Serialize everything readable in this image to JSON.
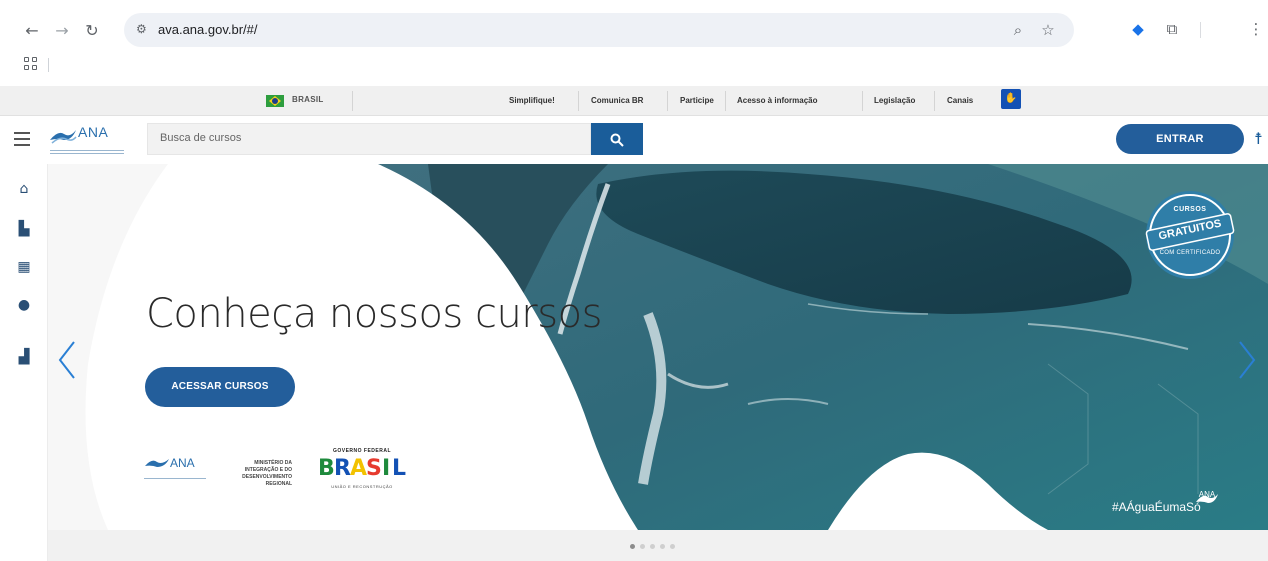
{
  "browser": {
    "url": "ava.ana.gov.br/#/",
    "back_icon": "arrow-left-icon",
    "forward_icon": "arrow-right-icon",
    "reload_icon": "reload-icon",
    "site_info_icon": "tune-icon",
    "zoom_icon": "zoom-icon",
    "bookmark_icon": "star-icon",
    "extension_icon": "extension-icon",
    "menu_icon": "kebab-menu-icon"
  },
  "govbar": {
    "brasil_label": "BRASIL",
    "links": [
      "Simplifique!",
      "Comunica BR",
      "Participe",
      "Acesso à informação",
      "Legislação",
      "Canais"
    ]
  },
  "header": {
    "logo_text": "ANA",
    "search_placeholder": "Busca de cursos",
    "login_label": "ENTRAR"
  },
  "sidebar": {
    "items": [
      {
        "icon": "home-icon"
      },
      {
        "icon": "institution-icon"
      },
      {
        "icon": "catalog-icon"
      },
      {
        "icon": "help-icon"
      },
      {
        "icon": "bar-chart-icon"
      }
    ]
  },
  "hero": {
    "title": "Conheça nossos cursos",
    "cta_label": "ACESSAR CURSOS",
    "badge_top": "CURSOS",
    "badge_main": "GRATUITOS",
    "badge_bottom": "COM CERTIFICADO",
    "hashtag": "#AÁguaÉumaSó",
    "corner_logo": "ANA",
    "partner_ana": "ANA",
    "ministry": "MINISTÉRIO DA INTEGRAÇÃO E DO DESENVOLVIMENTO REGIONAL",
    "gov_top": "GOVERNO FEDERAL",
    "gov_word": "BRASIL",
    "gov_bottom": "UNIÃO E RECONSTRUÇÃO"
  },
  "carousel": {
    "slide_count": 5,
    "active_slide": 1
  },
  "colors": {
    "primary": "#235e9b",
    "accent_blue": "#1351b4",
    "hero_water": "#2d6a7a"
  }
}
